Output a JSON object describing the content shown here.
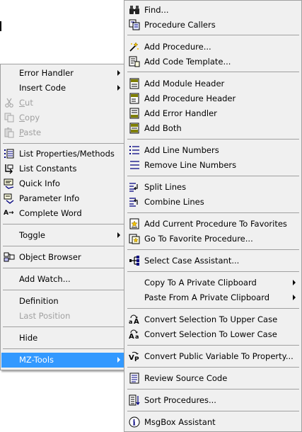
{
  "main_menu": {
    "items": [
      {
        "label": "Error Handler",
        "submenu": true
      },
      {
        "label": "Insert Code",
        "submenu": true
      },
      {
        "label": "Cut",
        "disabled": true,
        "icon": "cut-icon"
      },
      {
        "label": "Copy",
        "disabled": true,
        "icon": "copy-icon"
      },
      {
        "label": "Paste",
        "disabled": true,
        "icon": "paste-icon"
      },
      {
        "label": "List Properties/Methods",
        "icon": "list-properties-icon"
      },
      {
        "label": "List Constants",
        "icon": "list-constants-icon"
      },
      {
        "label": "Quick Info",
        "icon": "quick-info-icon"
      },
      {
        "label": "Parameter Info",
        "icon": "parameter-info-icon"
      },
      {
        "label": "Complete Word",
        "icon": "complete-word-icon"
      },
      {
        "label": "Toggle",
        "submenu": true
      },
      {
        "label": "Object Browser",
        "icon": "object-browser-icon"
      },
      {
        "label": "Add Watch..."
      },
      {
        "label": "Definition"
      },
      {
        "label": "Last Position",
        "disabled": true
      },
      {
        "label": "Hide"
      },
      {
        "label": "MZ-Tools",
        "submenu": true,
        "selected": true
      }
    ]
  },
  "sub_menu": {
    "items": [
      {
        "label": "Find...",
        "icon": "binoculars-icon"
      },
      {
        "label": "Procedure Callers",
        "icon": "procedure-callers-icon"
      },
      {
        "label": "Add Procedure...",
        "icon": "add-procedure-icon"
      },
      {
        "label": "Add Code Template...",
        "icon": "code-template-icon"
      },
      {
        "label": "Add Module Header",
        "icon": "module-header-icon"
      },
      {
        "label": "Add Procedure Header",
        "icon": "procedure-header-icon"
      },
      {
        "label": "Add Error Handler",
        "icon": "error-handler-icon"
      },
      {
        "label": "Add Both",
        "icon": "add-both-icon"
      },
      {
        "label": "Add Line Numbers",
        "icon": "line-numbers-icon"
      },
      {
        "label": "Remove Line Numbers",
        "icon": "remove-line-numbers-icon"
      },
      {
        "label": "Split Lines",
        "icon": "split-lines-icon"
      },
      {
        "label": "Combine Lines",
        "icon": "combine-lines-icon"
      },
      {
        "label": "Add Current Procedure To Favorites",
        "icon": "favorites-add-icon"
      },
      {
        "label": "Go To Favorite Procedure...",
        "icon": "favorites-goto-icon"
      },
      {
        "label": "Select Case Assistant...",
        "icon": "select-case-icon"
      },
      {
        "label": "Copy To A Private Clipboard",
        "submenu": true
      },
      {
        "label": "Paste From A Private Clipboard",
        "submenu": true
      },
      {
        "label": "Convert Selection To Upper Case",
        "icon": "upper-case-icon"
      },
      {
        "label": "Convert Selection To Lower Case",
        "icon": "lower-case-icon"
      },
      {
        "label": "Convert Public Variable To Property...",
        "icon": "variable-to-property-icon"
      },
      {
        "label": "Review Source Code",
        "icon": "review-source-icon"
      },
      {
        "label": "Sort Procedures...",
        "icon": "sort-procedures-icon"
      },
      {
        "label": "MsgBox Assistant",
        "icon": "msgbox-icon"
      }
    ]
  },
  "icon_glyphs": {
    "complete_word": "A→"
  },
  "colors": {
    "menu_bg": "#f0f0f0",
    "selection": "#3399ff",
    "disabled_text": "#a0a0a0"
  }
}
